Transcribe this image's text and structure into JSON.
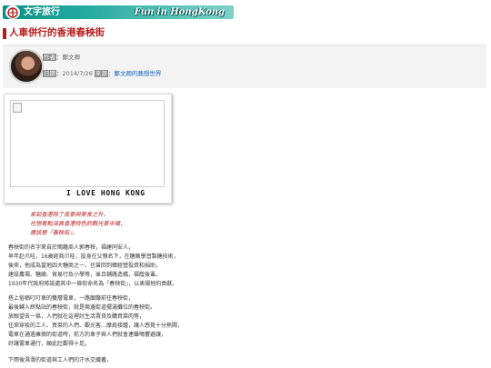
{
  "banner": {
    "section_label": "文字旅行",
    "tagline": "Fun in HongKong",
    "logo_icon": "mtr-logo-icon",
    "gradient_start": "#0a8f86"
  },
  "article": {
    "title": "人車併行的香港春秧街",
    "accent_color": "#b71c1c"
  },
  "meta": {
    "author_label": "作者",
    "author_value": "鄭文卿",
    "date_label": "日期",
    "date_value": "2014/7/26",
    "source_label": "來源",
    "source_value": "鄭文卿的藝想世界"
  },
  "photo": {
    "caption": "I LOVE HONG KONG"
  },
  "quote_lines": [
    "來到香港除了夜景與美食之外，",
    "也想看點深具香港特色的觀光景市場，",
    "應該是『春秧街』。"
  ],
  "paragraphs": [
    [
      "春秧街的名字來自於閩籍商人郭春秧，福建同安人，",
      "早年赴爪哇，16歲經商爪哇，投身在父親名下，在糖廠學習製糖技術，",
      "後來，他成為當地四大糖商之一，也曾回到鄉經營投資和捐助，",
      "建設農場、糖廠、貿易行及小學等，並且鋪路造橋，福蔭後輩。",
      "1930年代政府將該處其中一條街命名為「春秧街」，以表揚他的貢獻。"
    ],
    [
      "搭上俗稱叮叮車的雙層電車，一路顛簸前往春秧街，",
      "最後轉入終點站的春秧街，就是兩邊街道擺滿攤位的春秧街。",
      "放眼望去一條，人們就在這裡討生活賣貨及購買菜肉等，",
      "往來穿梭的工人、買菜的人們、觀光客…摩肩接踵，讓人感覺十分熱鬧，",
      "電車在通過擁擠的街道時，前方的車子與人們就會連聲鳴響避讓，",
      "好讓電車通行，頗此壯觀得十足。"
    ],
    [
      "下雨後濕滑的街道與工人們的汗水交織著，"
    ]
  ]
}
